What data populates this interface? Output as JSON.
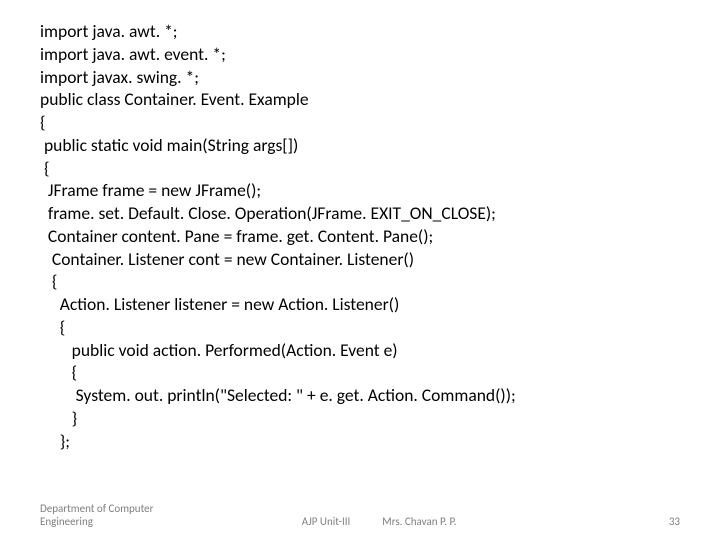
{
  "code": {
    "l1": "import java. awt. *;",
    "l2": "import java. awt. event. *;",
    "l3": "import javax. swing. *;",
    "l4": "",
    "l5": "public class Container. Event. Example",
    "l6": "{",
    "l7": " public static void main(String args[])",
    "l8": " {",
    "l9": "  JFrame frame = new JFrame();",
    "l10": "  frame. set. Default. Close. Operation(JFrame. EXIT_ON_CLOSE);",
    "l11": "  Container content. Pane = frame. get. Content. Pane();",
    "l12": "",
    "l13": "   Container. Listener cont = new Container. Listener()",
    "l14": "   {",
    "l15": "     Action. Listener listener = new Action. Listener()",
    "l16": "     {",
    "l17": "        public void action. Performed(Action. Event e)",
    "l18": "        {",
    "l19": "         System. out. println(\"Selected: \" + e. get. Action. Command());",
    "l20": "        }",
    "l21": "     };"
  },
  "footer": {
    "left": "Department of Computer Engineering",
    "center": "AJP Unit-III",
    "author": "Mrs. Chavan P. P.",
    "page": "33"
  }
}
